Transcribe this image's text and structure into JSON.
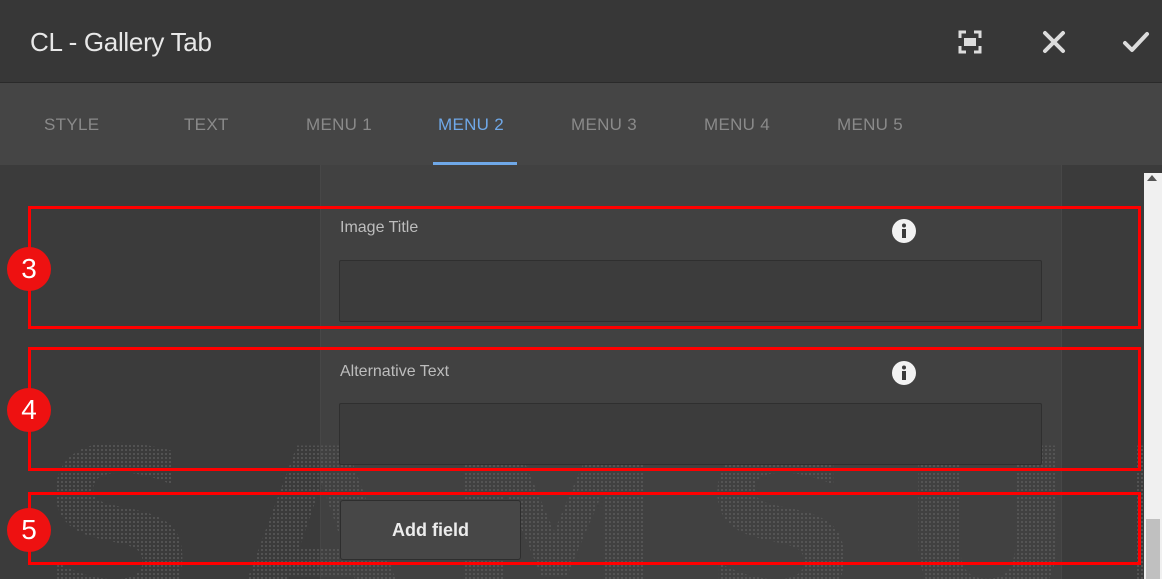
{
  "dialog": {
    "title": "CL - Gallery Tab",
    "fullscreen_icon": "fullscreen-icon",
    "close_icon": "close-icon",
    "confirm_icon": "checkmark-icon"
  },
  "tabs": [
    {
      "label": "STYLE"
    },
    {
      "label": "TEXT"
    },
    {
      "label": "MENU 1"
    },
    {
      "label": "MENU 2",
      "active": true
    },
    {
      "label": "MENU 3"
    },
    {
      "label": "MENU 4"
    },
    {
      "label": "MENU 5"
    }
  ],
  "fields": {
    "image_title": {
      "label": "Image Title",
      "value": "",
      "info_icon": "info-icon"
    },
    "alternative_text": {
      "label": "Alternative Text",
      "value": "",
      "info_icon": "info-icon"
    }
  },
  "add_field": {
    "label": "Add field"
  },
  "watermark": {
    "text": "SAMSUNG"
  },
  "annotations": [
    {
      "number": "3"
    },
    {
      "number": "4"
    },
    {
      "number": "5"
    }
  ],
  "colors": {
    "accent": "#6fa8e8",
    "annotation": "#ff0000",
    "dialog_bg": "#373737"
  }
}
